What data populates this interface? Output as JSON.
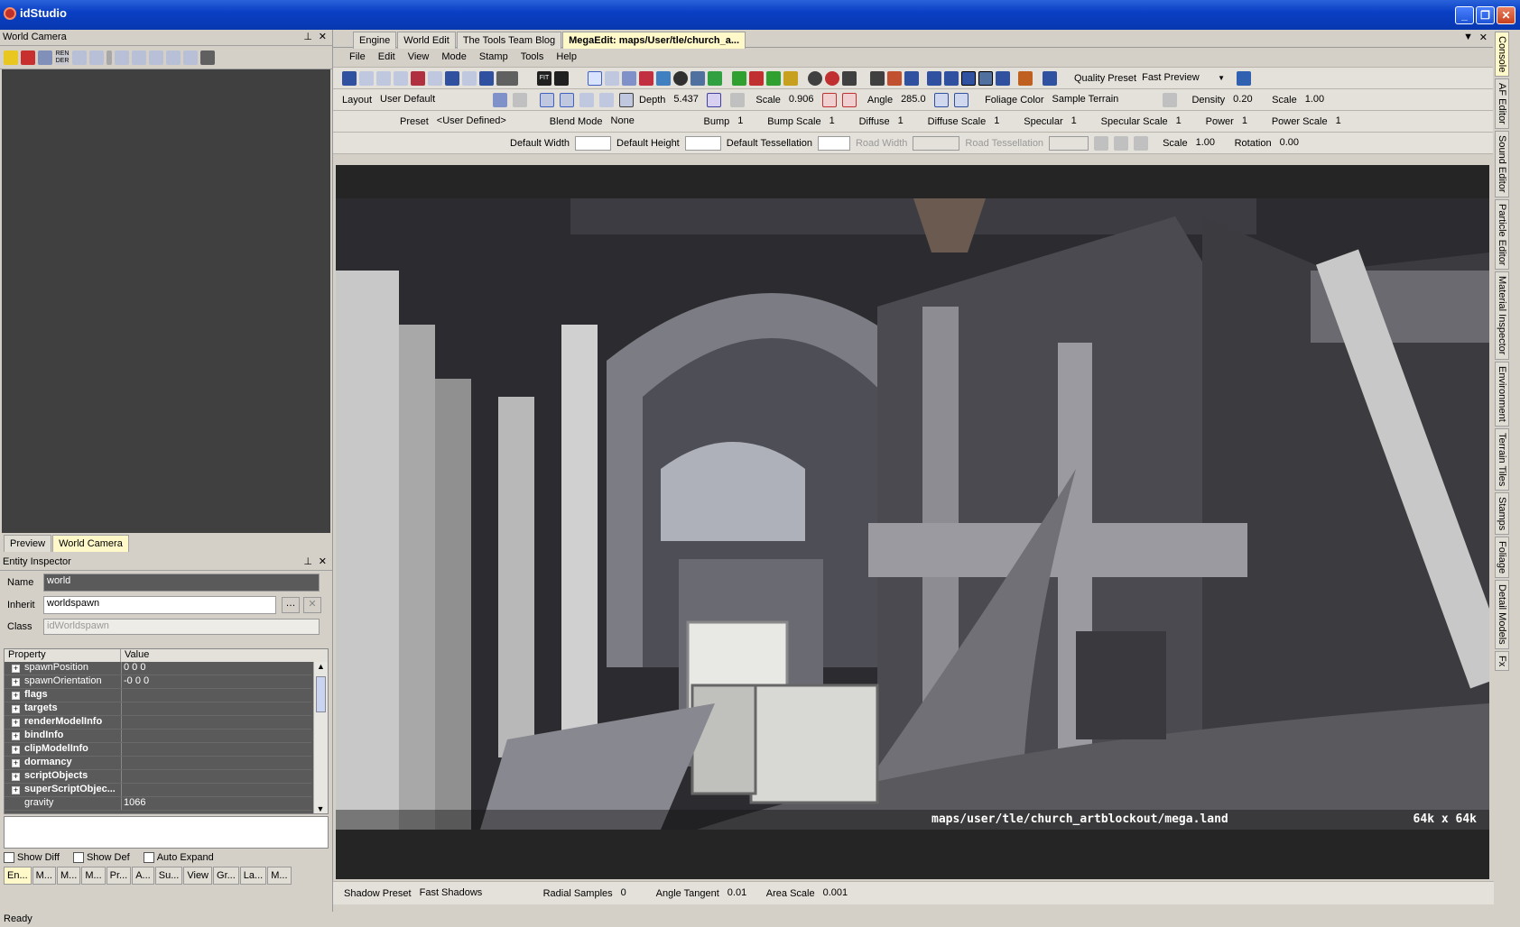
{
  "app": {
    "title": "idStudio"
  },
  "left": {
    "world_camera": {
      "title": "World Camera"
    },
    "preview_tabs": [
      "Preview",
      "World Camera"
    ],
    "inspector": {
      "title": "Entity Inspector",
      "name_label": "Name",
      "name_value": "world",
      "inherit_label": "Inherit",
      "inherit_value": "worldspawn",
      "class_label": "Class",
      "class_value": "idWorldspawn",
      "col_property": "Property",
      "col_value": "Value",
      "rows": [
        {
          "name": "spawnPosition",
          "value": "0 0 0",
          "bold": false
        },
        {
          "name": "spawnOrientation",
          "value": "-0 0 0",
          "bold": false
        },
        {
          "name": "flags",
          "value": "",
          "bold": true
        },
        {
          "name": "targets",
          "value": "",
          "bold": true
        },
        {
          "name": "renderModelInfo",
          "value": "",
          "bold": true
        },
        {
          "name": "bindInfo",
          "value": "",
          "bold": true
        },
        {
          "name": "clipModelInfo",
          "value": "",
          "bold": true
        },
        {
          "name": "dormancy",
          "value": "",
          "bold": true
        },
        {
          "name": "scriptObjects",
          "value": "",
          "bold": true
        },
        {
          "name": "superScriptObjec...",
          "value": "",
          "bold": true
        },
        {
          "name": "gravity",
          "value": "1066",
          "bold": false
        }
      ],
      "show_diff": "Show Diff",
      "show_def": "Show Def",
      "auto_expand": "Auto Expand"
    },
    "bottom_tabs": [
      "En...",
      "M...",
      "M...",
      "M...",
      "Pr...",
      "A...",
      "Su...",
      "View",
      "Gr...",
      "La...",
      "M..."
    ]
  },
  "status": "Ready",
  "doc_tabs": [
    "Engine",
    "World Edit",
    "The Tools Team Blog",
    "MegaEdit: maps/User/tle/church_a..."
  ],
  "menu": [
    "File",
    "Edit",
    "View",
    "Mode",
    "Stamp",
    "Tools",
    "Help"
  ],
  "toolbar1": {
    "quality_label": "Quality Preset",
    "quality_value": "Fast Preview"
  },
  "toolbar2": {
    "layout_label": "Layout",
    "layout_value": "User Default",
    "depth_label": "Depth",
    "depth_value": "5.437",
    "scale_label": "Scale",
    "scale_value": "0.906",
    "angle_label": "Angle",
    "angle_value": "285.0",
    "foliage_label": "Foliage Color",
    "foliage_value": "Sample Terrain",
    "density_label": "Density",
    "density_value": "0.20",
    "scale2_label": "Scale",
    "scale2_value": "1.00"
  },
  "toolbar3": {
    "preset_label": "Preset",
    "preset_value": "<User Defined>",
    "blend_label": "Blend Mode",
    "blend_value": "None",
    "bump_label": "Bump",
    "bump_value": "1",
    "bumpscale_label": "Bump Scale",
    "bumpscale_value": "1",
    "diffuse_label": "Diffuse",
    "diffuse_value": "1",
    "diffusescale_label": "Diffuse Scale",
    "diffusescale_value": "1",
    "specular_label": "Specular",
    "specular_value": "1",
    "specularscale_label": "Specular Scale",
    "specularscale_value": "1",
    "power_label": "Power",
    "power_value": "1",
    "powerscale_label": "Power Scale",
    "powerscale_value": "1"
  },
  "toolbar4": {
    "dw_label": "Default Width",
    "dh_label": "Default Height",
    "dt_label": "Default Tessellation",
    "rw_label": "Road Width",
    "rt_label": "Road Tessellation",
    "scale_label": "Scale",
    "scale_value": "1.00",
    "rotation_label": "Rotation",
    "rotation_value": "0.00"
  },
  "viewport": {
    "path": "maps/user/tle/church_artblockout/mega.land",
    "size": "64k x 64k"
  },
  "bottom_bar": {
    "shadow_label": "Shadow Preset",
    "shadow_value": "Fast Shadows",
    "radial_label": "Radial Samples",
    "radial_value": "0",
    "angle_label": "Angle Tangent",
    "angle_value": "0.01",
    "area_label": "Area Scale",
    "area_value": "0.001"
  },
  "right_tabs": [
    "Console",
    "AF Editor",
    "Sound Editor",
    "Particle Editor",
    "Material Inspector",
    "Environment",
    "Terrain Tiles",
    "Stamps",
    "Foliage",
    "Detail Models",
    "Fx"
  ]
}
